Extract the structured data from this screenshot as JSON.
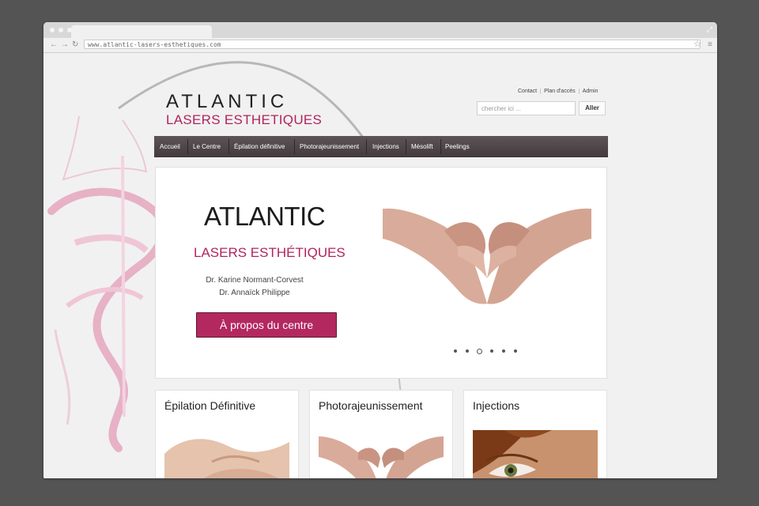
{
  "browser": {
    "url": "www.atlantic-lasers-esthetiques.com",
    "icons": [
      "back-arrow-icon",
      "forward-arrow-icon",
      "reload-icon",
      "star-icon",
      "menu-icon"
    ]
  },
  "site": {
    "logo_line1": "ATLANTIC",
    "logo_line2": "LASERS ESTHETIQUES",
    "top_links": [
      "Contact",
      "Plan d'accès",
      "Admin"
    ],
    "search_placeholder": "chercher ici ...",
    "search_button": "Aller",
    "nav": [
      "Accueil",
      "Le Centre",
      "Épilation définitive",
      "Photorajeunissement",
      "Injections",
      "Mésolift",
      "Peelings"
    ]
  },
  "hero": {
    "title": "ATLANTIC",
    "subtitle": "LASERS ESTHÉTIQUES",
    "doctor1": "Dr. Karine Normant-Corvest",
    "doctor2": "Dr. Annaïck Philippe",
    "button": "À propos du centre",
    "slide_count": 6,
    "active_slide": 3
  },
  "cards": [
    {
      "title": "Épilation Définitive"
    },
    {
      "title": "Photorajeunissement"
    },
    {
      "title": "Injections"
    }
  ],
  "colors": {
    "accent": "#b0245e",
    "nav_bg": "#4a4245",
    "frame_bg": "#545454"
  }
}
